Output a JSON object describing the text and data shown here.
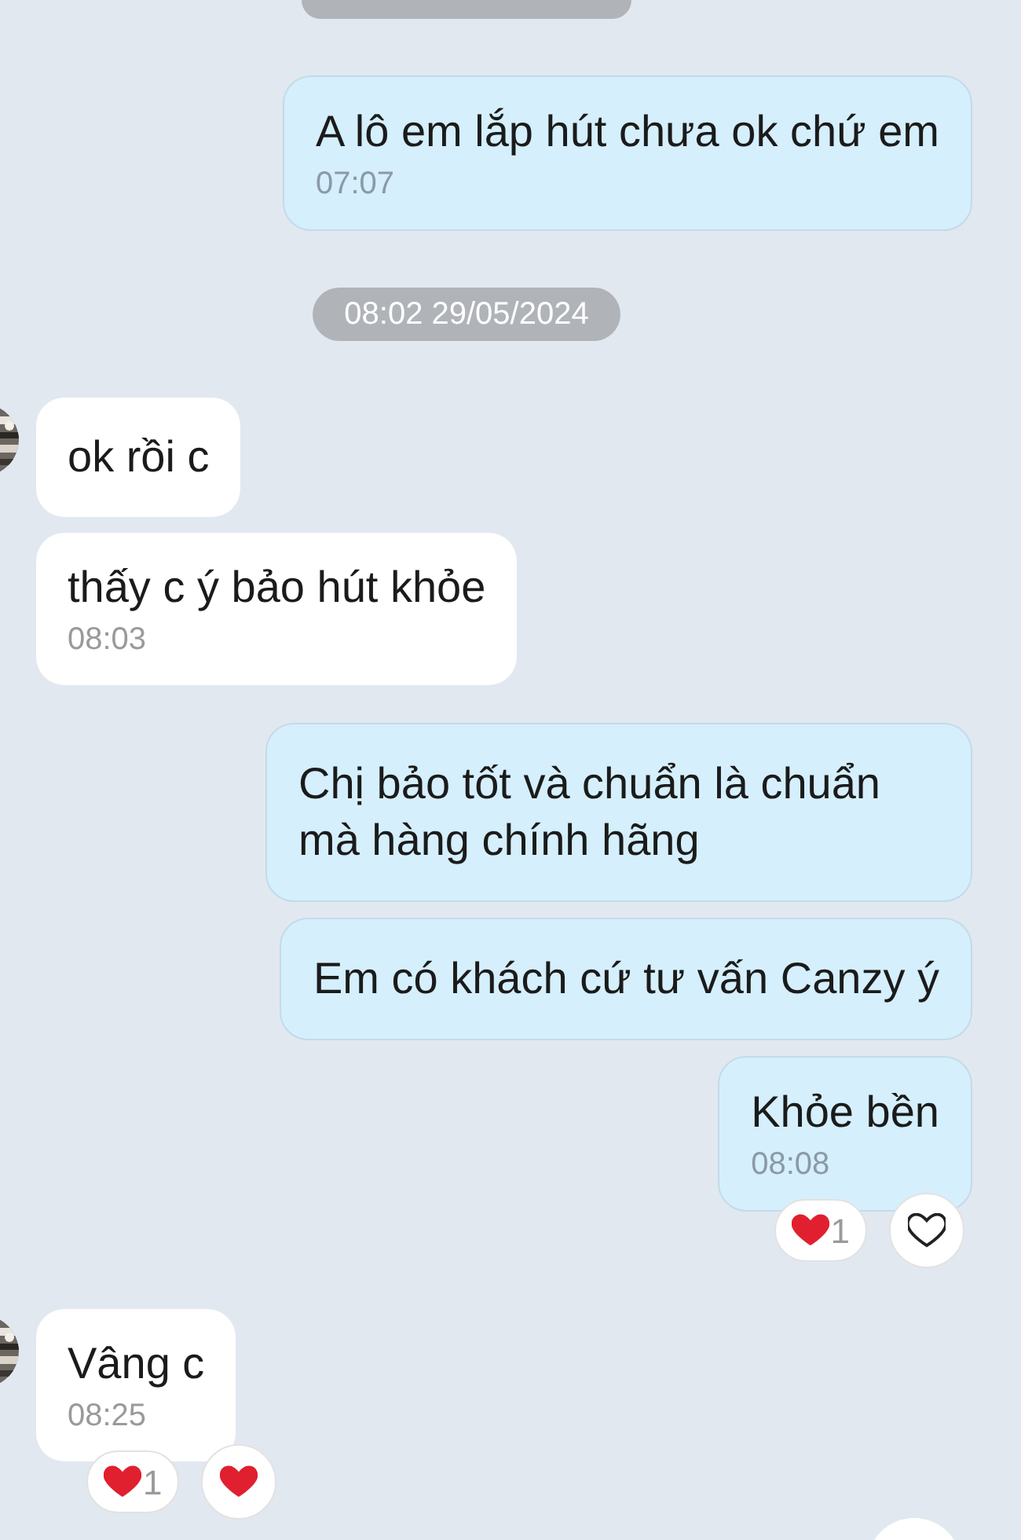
{
  "items": [
    {
      "kind": "date",
      "clipped": true
    },
    {
      "kind": "message",
      "outgoing": true,
      "text": "A lô em lắp hút chưa ok chứ em",
      "time": "07:07"
    },
    {
      "kind": "date",
      "clipped": false,
      "text": "08:02 29/05/2024"
    },
    {
      "kind": "message",
      "outgoing": false,
      "avatar": true,
      "text": "ok rồi c"
    },
    {
      "kind": "message",
      "outgoing": false,
      "avatar": false,
      "text": "thấy c ý bảo hút khỏe",
      "time": "08:03"
    },
    {
      "kind": "message",
      "outgoing": true,
      "text": "Chị bảo tốt và chuẩn là chuẩn mà hàng chính hãng"
    },
    {
      "kind": "message",
      "outgoing": true,
      "text": "Em có khách cứ tư vấn Canzy ý"
    },
    {
      "kind": "message",
      "outgoing": true,
      "text": "Khỏe bền",
      "time": "08:08",
      "reactions": {
        "count": "1",
        "my_reaction": false
      }
    },
    {
      "kind": "message",
      "outgoing": false,
      "avatar": true,
      "text": "Vâng c",
      "time": "08:25",
      "reactions": {
        "count": "1",
        "my_reaction": true
      }
    }
  ],
  "scroll_button": true
}
